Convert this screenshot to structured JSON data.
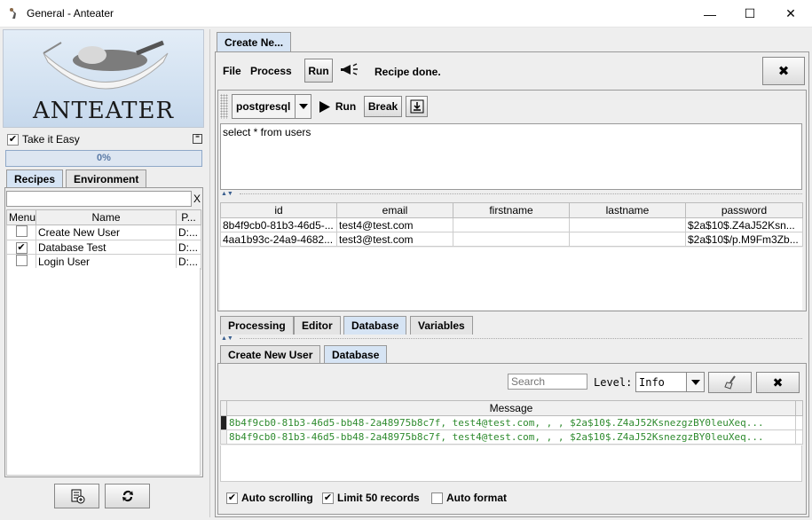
{
  "window": {
    "title": "General - Anteater",
    "minimize": "—",
    "maximize": "☐",
    "close": "✕"
  },
  "left": {
    "logo_text": "ANTEATER",
    "take_it_easy": "Take it Easy",
    "progress": "0%",
    "tabs": [
      "Recipes",
      "Environment"
    ],
    "search_clear": "X",
    "columns": [
      "Menu",
      "Name",
      "P..."
    ],
    "recipes": [
      {
        "checked": false,
        "name": "Create New User",
        "path": "D:..."
      },
      {
        "checked": true,
        "name": "Database Test",
        "path": "D:..."
      },
      {
        "checked": false,
        "name": "Login User",
        "path": "D:..."
      }
    ]
  },
  "top_tab": "Create Ne...",
  "toolbar": {
    "file": "File",
    "process": "Process",
    "run": "Run",
    "status": "Recipe done.",
    "close": "✖"
  },
  "db": {
    "driver": "postgresql",
    "run": "Run",
    "break": "Break",
    "query": "select * from users",
    "columns": [
      "id",
      "email",
      "firstname",
      "lastname",
      "password"
    ],
    "rows": [
      [
        "8b4f9cb0-81b3-46d5-...",
        "test4@test.com",
        "",
        "",
        "$2a$10$.Z4aJ52Ksn..."
      ],
      [
        "4aa1b93c-24a9-4682...",
        "test3@test.com",
        "",
        "",
        "$2a$10$/p.M9Fm3Zb..."
      ]
    ]
  },
  "mid_tabs": [
    "Processing",
    "Editor",
    "Database",
    "Variables"
  ],
  "log_tabs": [
    "Create New User",
    "Database"
  ],
  "log": {
    "search_placeholder": "Search",
    "level_label": "Level:",
    "level_value": "Info",
    "header": "Message",
    "lines": [
      "8b4f9cb0-81b3-46d5-bb48-2a48975b8c7f, test4@test.com, , , $2a$10$.Z4aJ52KsnezgzBY0leuXeq...",
      "8b4f9cb0-81b3-46d5-bb48-2a48975b8c7f, test4@test.com, , , $2a$10$.Z4aJ52KsnezgzBY0leuXeq..."
    ],
    "auto_scrolling": "Auto scrolling",
    "limit": "Limit 50 records",
    "auto_format": "Auto format"
  },
  "colors": {
    "log_text": "#2e8b2e",
    "tab_selected": "#d6e4f4"
  }
}
